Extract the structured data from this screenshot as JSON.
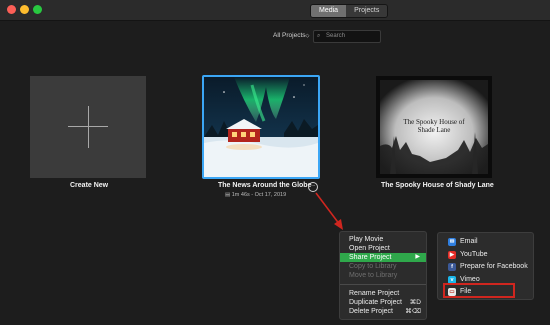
{
  "toolbar": {
    "tabs": [
      {
        "label": "Media",
        "active": true
      },
      {
        "label": "Projects",
        "active": false
      }
    ]
  },
  "filter": {
    "label": "All Projects",
    "search_placeholder": "Search"
  },
  "projects": [
    {
      "title": "Create New"
    },
    {
      "title": "The News Around the Globe",
      "meta": "1m 46s - Oct 17, 2019",
      "selected": true
    },
    {
      "title": "The Spooky House of Shady Lane",
      "thumb_text": "The Spooky House of Shade Lane"
    }
  ],
  "context_menu": {
    "items": [
      {
        "label": "Play Movie",
        "enabled": true
      },
      {
        "label": "Open Project",
        "enabled": true
      },
      {
        "label": "Share Project",
        "enabled": true,
        "selected": true,
        "submenu_arrow": "▶"
      },
      {
        "label": "Copy to Library",
        "enabled": false
      },
      {
        "label": "Move to Library",
        "enabled": false
      },
      {
        "label": "Rename Project",
        "enabled": true
      },
      {
        "label": "Duplicate Project",
        "enabled": true,
        "shortcut": "⌘D"
      },
      {
        "label": "Delete Project",
        "enabled": true,
        "shortcut": "⌘⌫"
      }
    ]
  },
  "share_menu": {
    "items": [
      {
        "label": "Email",
        "icon": "mail-icon",
        "icon_color": "#2f7fe0"
      },
      {
        "label": "YouTube",
        "icon": "youtube-icon",
        "icon_color": "#e52d27"
      },
      {
        "label": "Prepare for Facebook",
        "icon": "facebook-icon",
        "icon_color": "#3b5998"
      },
      {
        "label": "Vimeo",
        "icon": "vimeo-icon",
        "icon_color": "#1ab7ea"
      },
      {
        "label": "File",
        "icon": "file-icon",
        "icon_color": "#e9e9e9",
        "highlighted": true
      }
    ]
  },
  "colors": {
    "accent_selection": "#2fa84b",
    "selected_tile_border": "#3ba6f5",
    "annotation": "#d0261f"
  }
}
